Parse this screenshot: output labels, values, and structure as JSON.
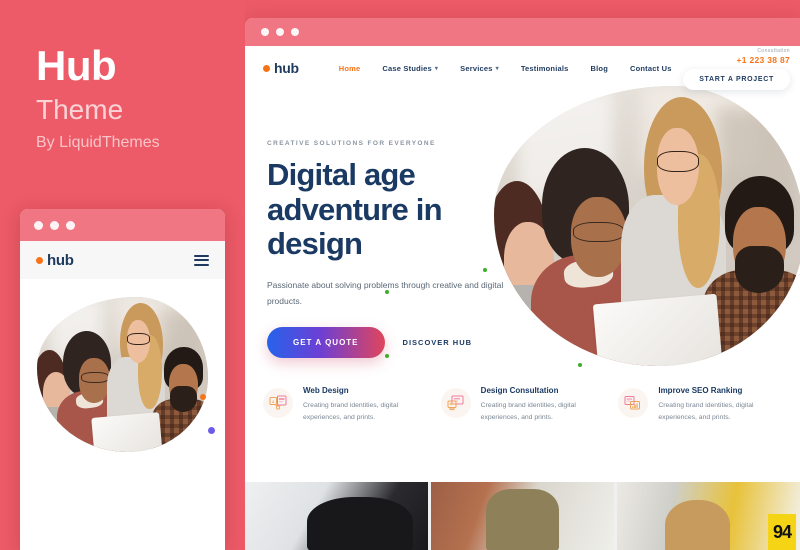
{
  "promo": {
    "title": "Hub",
    "subtitle": "Theme",
    "byline": "By LiquidThemes",
    "background_color": "#ec5b67"
  },
  "mobile_mockup": {
    "chrome_color": "#ef7682",
    "logo_text": "hub",
    "menu_icon": "hamburger-icon"
  },
  "browser": {
    "chrome_color": "#ef7682",
    "site": {
      "logo_text": "hub",
      "nav_links": [
        {
          "label": "Home",
          "active": true,
          "has_dropdown": false
        },
        {
          "label": "Case Studies",
          "active": false,
          "has_dropdown": true
        },
        {
          "label": "Services",
          "active": false,
          "has_dropdown": true
        },
        {
          "label": "Testimonials",
          "active": false,
          "has_dropdown": false
        },
        {
          "label": "Blog",
          "active": false,
          "has_dropdown": false
        },
        {
          "label": "Contact Us",
          "active": false,
          "has_dropdown": false
        }
      ],
      "consultation": {
        "label": "Consultation",
        "phone": "+1 223 38 87"
      },
      "cta_button": "START A PROJECT",
      "hero": {
        "eyebrow": "CREATIVE SOLUTIONS FOR EVERYONE",
        "headline": "Digital age adventure in design",
        "subcopy": "Passionate about solving problems through creative and digital products.",
        "primary_button": "GET A QUOTE",
        "secondary_button": "DISCOVER HUB",
        "accent_colors": {
          "headline": "#1b3a63",
          "brand_orange": "#f97316",
          "dot_green": "#3fae2a",
          "dot_purple": "#6d5ce7"
        }
      },
      "features": [
        {
          "icon": "web-design-icon",
          "title": "Web Design",
          "description": "Creating brand identities, digital experiences, and prints."
        },
        {
          "icon": "design-consultation-icon",
          "title": "Design Consultation",
          "description": "Creating brand identities, digital experiences, and prints."
        },
        {
          "icon": "seo-ranking-icon",
          "title": "Improve SEO Ranking",
          "description": "Creating brand identities, digital experiences, and prints."
        }
      ],
      "photo_strip": {
        "badge_text": "94"
      }
    }
  }
}
